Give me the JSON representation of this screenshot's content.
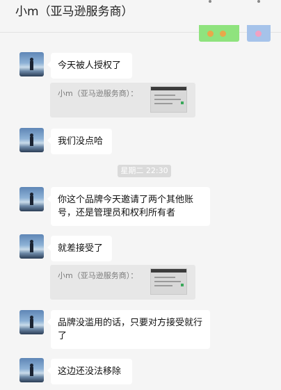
{
  "header": {
    "title": "小m（亚马逊服务商）"
  },
  "messages": [
    {
      "text": "今天被人授权了"
    },
    {
      "text": "我们没点哈"
    },
    {
      "text": "你这个品牌今天邀请了两个其他账号，还是管理员和权利所有者"
    },
    {
      "text": "就差接受了"
    },
    {
      "text": "品牌没滥用的话，只要对方接受就行了"
    },
    {
      "text": "这边还没法移除"
    }
  ],
  "quotes": [
    {
      "sender": "小m（亚马逊服务商）："
    },
    {
      "sender": "小m（亚马逊服务商）："
    }
  ],
  "timestamp": "星期二 22:30",
  "colors": {
    "background": "#f5f5f5",
    "bubble": "#ffffff",
    "quote": "#e7e7e7",
    "sticker_green": "#8fe37e",
    "sticker_blue": "#a6c3ea"
  }
}
